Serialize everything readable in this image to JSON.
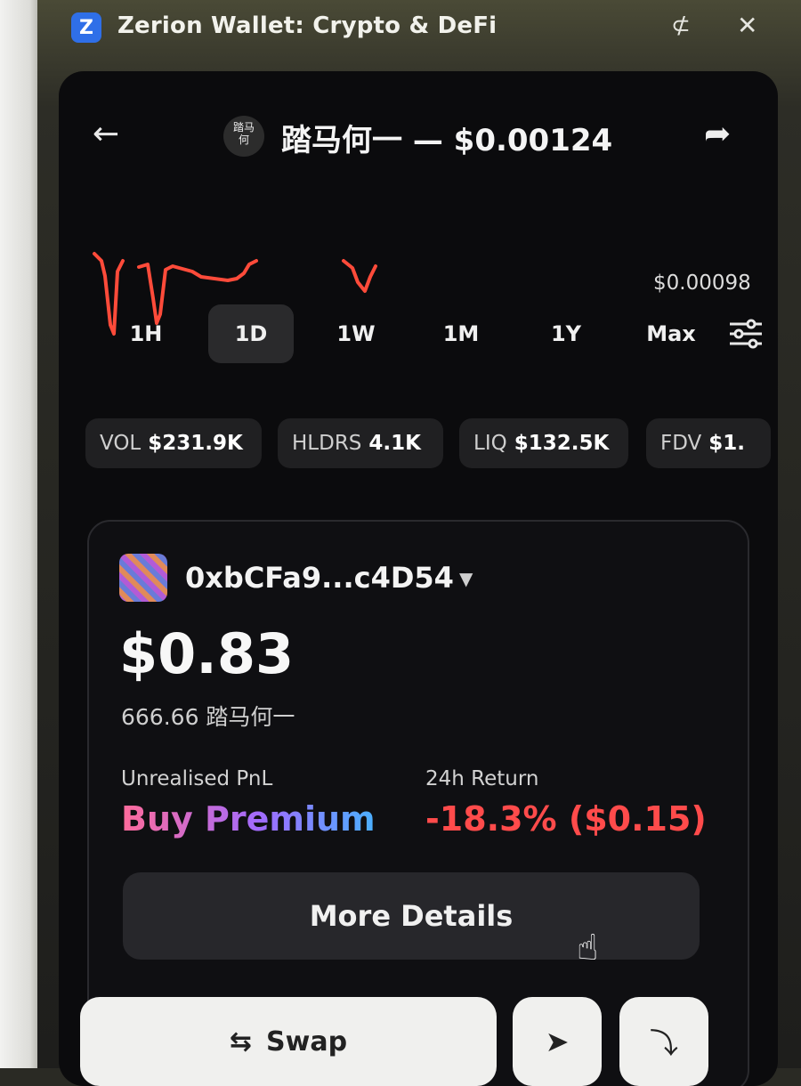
{
  "window": {
    "title": "Zerion Wallet: Crypto & DeFi",
    "app_icon": "zerion-logo",
    "pin_icon": "pin-off-icon",
    "close_icon": "close-icon"
  },
  "header": {
    "back_icon": "arrow-left-icon",
    "token_icon_text": "踏马\n何",
    "title": "踏马何一 — $0.00124",
    "share_icon": "share-icon"
  },
  "chart": {
    "min_price_label": "$0.00098",
    "line_color": "#ff4b3a"
  },
  "timeframes": {
    "items": [
      "1H",
      "1D",
      "1W",
      "1M",
      "1Y",
      "Max"
    ],
    "selected": "1D",
    "settings_icon": "sliders-icon"
  },
  "stats": [
    {
      "key": "VOL",
      "value": "$231.9K"
    },
    {
      "key": "HLDRS",
      "value": "4.1K"
    },
    {
      "key": "LIQ",
      "value": "$132.5K"
    },
    {
      "key": "FDV",
      "value": "$1."
    }
  ],
  "position": {
    "wallet_address": "0xbCFa9...c4D54",
    "caret_icon": "chevron-down-icon",
    "balance": "$0.83",
    "token_amount": "666.66 踏马何一",
    "pnl_label": "Unrealised PnL",
    "pnl_value": "Buy Premium",
    "return_label": "24h Return",
    "return_value": "-18.3% ($0.15)",
    "more_details_label": "More Details"
  },
  "actions": {
    "swap_label": "Swap",
    "swap_icon": "swap-arrows-icon",
    "send_icon": "send-icon",
    "receive_icon": "receive-icon"
  },
  "colors": {
    "negative": "#ff4b4b",
    "panel_bg": "#0b0b0d"
  }
}
